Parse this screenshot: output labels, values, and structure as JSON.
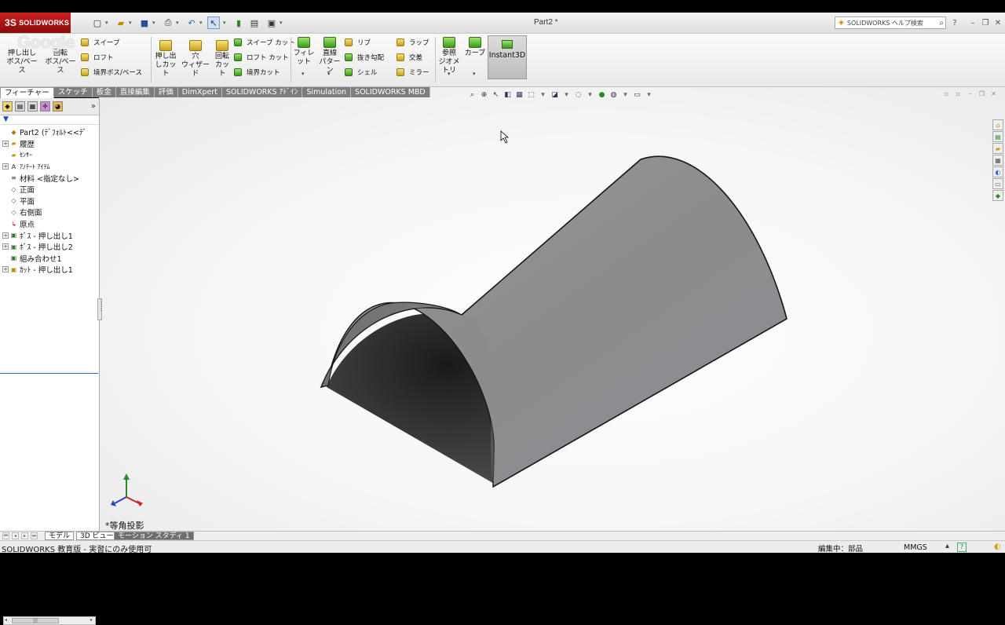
{
  "app": {
    "brand": "SOLIDWORKS",
    "brand_mark": "3S",
    "document_title": "Part2 *",
    "help_search_placeholder": "SOLIDWORKS ヘルプ検索",
    "google_watermark": "Google"
  },
  "ribbon": {
    "extrude_boss": [
      "押し出し",
      "ボス/ベース"
    ],
    "revolve_boss": [
      "回転",
      "ボス/ベース"
    ],
    "sweep": "スイープ",
    "loft": "ロフト",
    "boundary_boss": "境界ボス/ベース",
    "extrude_cut": [
      "押し出",
      "しカット"
    ],
    "hole_wizard": [
      "穴",
      "ウィザード"
    ],
    "revolve_cut": [
      "回転",
      "カット"
    ],
    "sweep_cut": "スイープ カット",
    "loft_cut": "ロフト カット",
    "boundary_cut": "境界カット",
    "fillet": "フィレット",
    "linear_pattern": [
      "直線",
      "パターン"
    ],
    "rib": "リブ",
    "draft": "抜き勾配",
    "shell": "シェル",
    "wrap": "ラップ",
    "intersect": "交差",
    "mirror": "ミラー",
    "reference_geometry": [
      "参照",
      "ジオメトリ"
    ],
    "curves": "カーブ",
    "instant3d": "Instant3D"
  },
  "tabs": [
    "フィーチャー",
    "スケッチ",
    "板金",
    "直接編集",
    "評価",
    "DimXpert",
    "SOLIDWORKS ｱﾄﾞｲﾝ",
    "Simulation",
    "SOLIDWORKS MBD"
  ],
  "tree": [
    {
      "label": "Part2 (ﾃﾞﾌｫﾙﾄ<<ﾃﾞ",
      "icon": "part-icon",
      "expand": false
    },
    {
      "label": "履歴",
      "icon": "history-folder-icon",
      "expand": true
    },
    {
      "label": "ｾﾝｻｰ",
      "icon": "sensor-folder-icon",
      "expand": false
    },
    {
      "label": "ｱﾉﾃｰﾄ ｱｲﾃﾑ",
      "icon": "annotations-icon",
      "expand": true
    },
    {
      "label": "材料 <指定なし>",
      "icon": "material-icon",
      "expand": false
    },
    {
      "label": "正面",
      "icon": "plane-icon",
      "expand": false
    },
    {
      "label": "平面",
      "icon": "plane-icon",
      "expand": false
    },
    {
      "label": "右側面",
      "icon": "plane-icon",
      "expand": false
    },
    {
      "label": "原点",
      "icon": "origin-icon",
      "expand": false
    },
    {
      "label": "ﾎﾞｽ - 押し出し1",
      "icon": "extrude-feature-icon",
      "expand": true
    },
    {
      "label": "ﾎﾞｽ - 押し出し2",
      "icon": "extrude-feature-icon",
      "expand": true
    },
    {
      "label": "組み合わせ1",
      "icon": "combine-feature-icon",
      "expand": false
    },
    {
      "label": "ｶｯﾄ - 押し出し1",
      "icon": "cut-feature-icon",
      "expand": true
    }
  ],
  "viewport": {
    "view_label": "*等角投影"
  },
  "bottom_tabs": [
    "モデル",
    "3D ビュー",
    "モーション スタディ 1"
  ],
  "status": {
    "left": "SOLIDWORKS 教育版 - 実習にのみ使用可",
    "editing": "編集中：部品",
    "units": "MMGS",
    "help": "?"
  },
  "colors": {
    "brand_red": "#b81818",
    "model_gray": "#8e8e8e",
    "tree_selection": "#2c6cd6"
  }
}
